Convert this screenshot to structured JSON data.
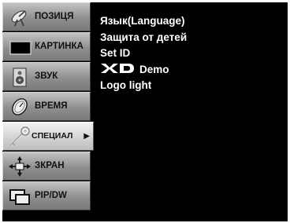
{
  "sidebar": {
    "items": [
      {
        "label": "ПОЗИЦЯ",
        "icon": "satellite-dish-icon"
      },
      {
        "label": "КАРТИНКА",
        "icon": "tv-screen-icon"
      },
      {
        "label": "ЗВУК",
        "icon": "speaker-icon"
      },
      {
        "label": "ВРЕМЯ",
        "icon": "clock-icon"
      },
      {
        "label": "СПЕЦИАЛ",
        "icon": "key-icon",
        "selected": true,
        "arrow": "▶"
      },
      {
        "label": "ЗКРАН",
        "icon": "move-cross-icon"
      },
      {
        "label": "PIP/DW",
        "icon": "pip-windows-icon"
      }
    ]
  },
  "submenu": {
    "items": [
      {
        "label": "Язык(Language)"
      },
      {
        "label": "Защита от детей"
      },
      {
        "label": "Set ID"
      },
      {
        "label": "Demo",
        "logo": "XD"
      },
      {
        "label": "Logo light"
      }
    ]
  },
  "colors": {
    "background": "#000000",
    "tab": "#9a9a9a",
    "tab_selected": "#d9d9d9",
    "text": "#ffffff"
  }
}
